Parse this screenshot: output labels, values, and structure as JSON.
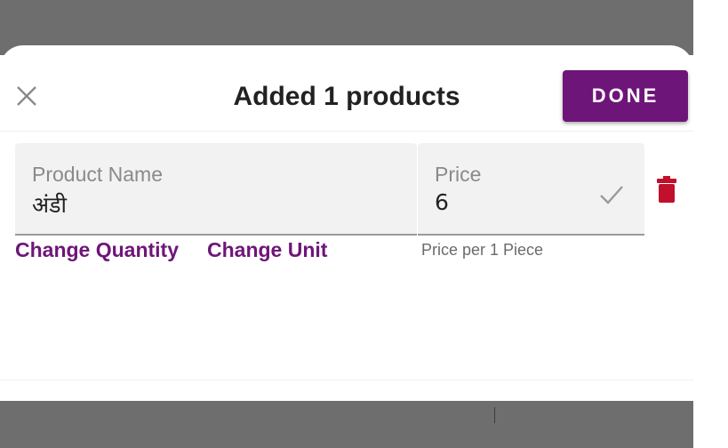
{
  "header": {
    "title": "Added 1 products",
    "done_label": "DONE",
    "close_icon": "close-icon"
  },
  "product": {
    "name_label": "Product Name",
    "name_value": "अंडी",
    "price_label": "Price",
    "price_value": "6",
    "price_hint": "Price per 1 Piece"
  },
  "actions": {
    "change_quantity": "Change Quantity",
    "change_unit": "Change Unit"
  },
  "icons": {
    "check": "check-icon",
    "delete": "trash-icon"
  },
  "colors": {
    "accent": "#6e1579",
    "delete": "#c1102b",
    "overlay": "#6e6e6e"
  }
}
